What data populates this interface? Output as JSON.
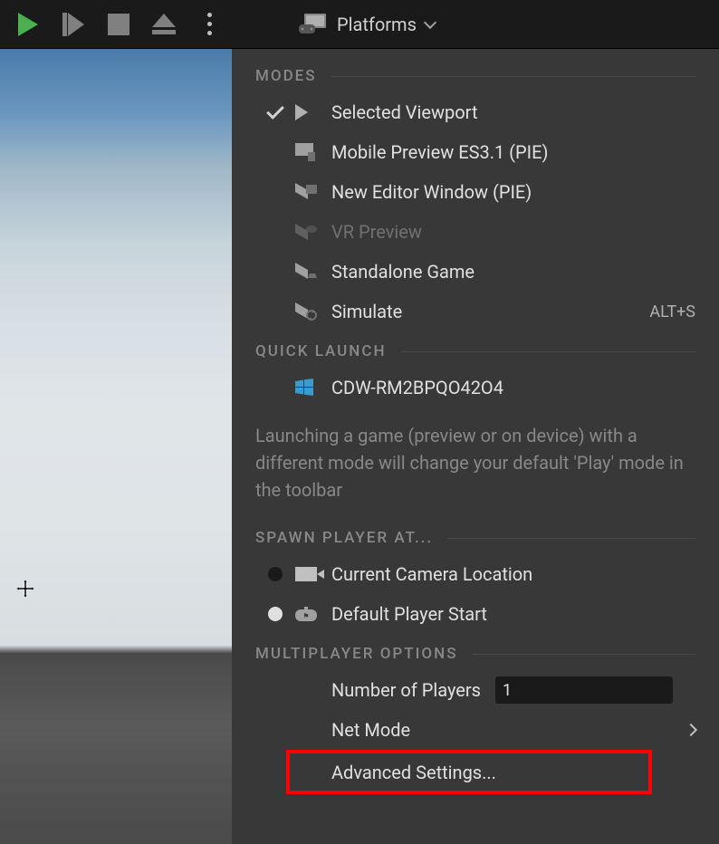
{
  "toolbar": {
    "platforms_label": "Platforms"
  },
  "menu": {
    "sections": {
      "modes_title": "MODES",
      "quicklaunch_title": "QUICK LAUNCH",
      "spawn_title": "SPAWN PLAYER AT...",
      "multiplayer_title": "MULTIPLAYER OPTIONS"
    },
    "modes": [
      {
        "label": "Selected Viewport",
        "checked": true
      },
      {
        "label": "Mobile Preview ES3.1 (PIE)"
      },
      {
        "label": "New Editor Window (PIE)"
      },
      {
        "label": "VR Preview",
        "disabled": true
      },
      {
        "label": "Standalone Game"
      },
      {
        "label": "Simulate",
        "shortcut": "ALT+S"
      }
    ],
    "quicklaunch": {
      "device": "CDW-RM2BPQO42O4"
    },
    "info_text": "Launching a game (preview or on device) with a different mode will change your default 'Play' mode in the toolbar",
    "spawn": [
      {
        "label": "Current Camera Location",
        "selected": false
      },
      {
        "label": "Default Player Start",
        "selected": true
      }
    ],
    "multiplayer": {
      "players_label": "Number of Players",
      "players_value": "1",
      "netmode_label": "Net Mode",
      "advanced_label": "Advanced Settings..."
    }
  }
}
